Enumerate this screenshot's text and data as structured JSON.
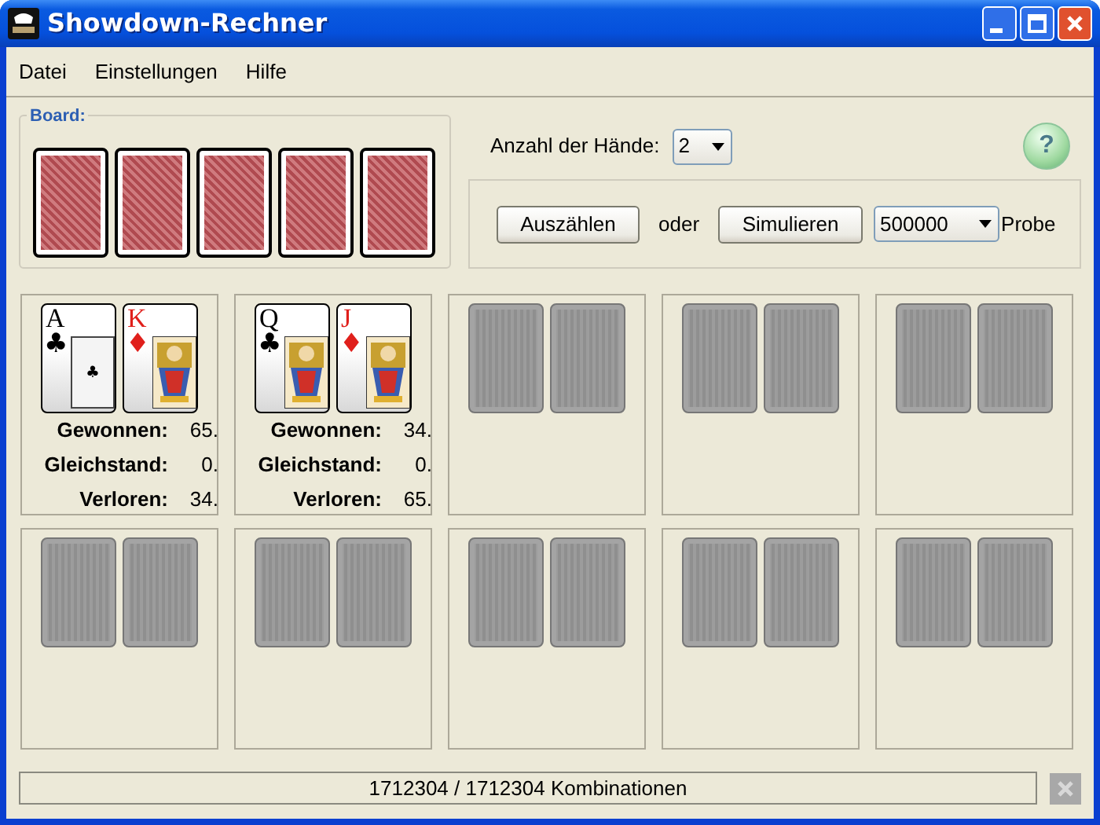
{
  "window": {
    "title": "Showdown-Rechner"
  },
  "menu": [
    "Datei",
    "Einstellungen",
    "Hilfe"
  ],
  "board": {
    "legend": "Board:",
    "cards": [
      {
        "kind": "back"
      },
      {
        "kind": "back"
      },
      {
        "kind": "back"
      },
      {
        "kind": "back"
      },
      {
        "kind": "back"
      }
    ]
  },
  "hands_count": {
    "label": "Anzahl der Hände:",
    "value": "2"
  },
  "help_button": {
    "label": "?"
  },
  "controls": {
    "count_button": "Auszählen",
    "or_text": "oder",
    "simulate_button": "Simulieren",
    "samples_value": "500000",
    "samples_label": "Probe"
  },
  "hands": [
    {
      "cards": [
        {
          "kind": "ace",
          "rank": "A",
          "suit": "♣",
          "red": false
        },
        {
          "kind": "face",
          "rank": "K",
          "suit": "♦",
          "red": true
        }
      ],
      "stats": [
        {
          "label": "Gewonnen:",
          "value": "65."
        },
        {
          "label": "Gleichstand:",
          "value": "0."
        },
        {
          "label": "Verloren:",
          "value": "34."
        }
      ]
    },
    {
      "cards": [
        {
          "kind": "face",
          "rank": "Q",
          "suit": "♣",
          "red": false
        },
        {
          "kind": "face",
          "rank": "J",
          "suit": "♦",
          "red": true
        }
      ],
      "stats": [
        {
          "label": "Gewonnen:",
          "value": "34."
        },
        {
          "label": "Gleichstand:",
          "value": "0."
        },
        {
          "label": "Verloren:",
          "value": "65."
        }
      ]
    },
    {
      "cards": [
        {
          "kind": "empty"
        },
        {
          "kind": "empty"
        }
      ]
    },
    {
      "cards": [
        {
          "kind": "empty"
        },
        {
          "kind": "empty"
        }
      ]
    },
    {
      "cards": [
        {
          "kind": "empty"
        },
        {
          "kind": "empty"
        }
      ]
    },
    {
      "cards": [
        {
          "kind": "empty"
        },
        {
          "kind": "empty"
        }
      ]
    },
    {
      "cards": [
        {
          "kind": "empty"
        },
        {
          "kind": "empty"
        }
      ]
    },
    {
      "cards": [
        {
          "kind": "empty"
        },
        {
          "kind": "empty"
        }
      ]
    },
    {
      "cards": [
        {
          "kind": "empty"
        },
        {
          "kind": "empty"
        }
      ]
    },
    {
      "cards": [
        {
          "kind": "empty"
        },
        {
          "kind": "empty"
        }
      ]
    }
  ],
  "status_bar": {
    "text": "1712304 / 1712304 Kombinationen"
  }
}
